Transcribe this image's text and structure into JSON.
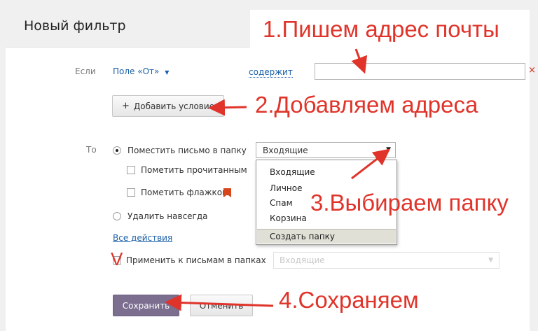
{
  "header": {
    "title": "Новый фильтр"
  },
  "condition": {
    "label": "Если",
    "field": "Поле «От»",
    "operator": "содержит",
    "value": "",
    "remove_icon": "×"
  },
  "add_condition": {
    "label": "Добавить условие"
  },
  "actions": {
    "label": "То",
    "move_to_folder": "Поместить письмо в папку",
    "mark_read": "Пометить прочитанным",
    "mark_flag": "Пометить флажком",
    "delete_forever": "Удалить навсегда",
    "all_actions": "Все действия"
  },
  "folder_select": {
    "selected": "Входящие",
    "options": [
      "Входящие",
      "Личное",
      "Спам",
      "Корзина"
    ],
    "create_folder": "Создать папку"
  },
  "apply_existing": {
    "label": "Применить к письмам в папках",
    "folder": "Входящие"
  },
  "buttons": {
    "save": "Сохранить",
    "cancel": "Отменить"
  },
  "annotations": {
    "step1": "1.Пишем адрес почты",
    "step2": "2.Добавляем адреса",
    "step3": "3.Выбираем папку",
    "step4": "4.Сохраняем",
    "checkmark": "V"
  },
  "colors": {
    "annotation": "#e0342a",
    "save_button": "#7b6e8f",
    "link": "#1a5fa8",
    "flag": "#d6451c"
  }
}
